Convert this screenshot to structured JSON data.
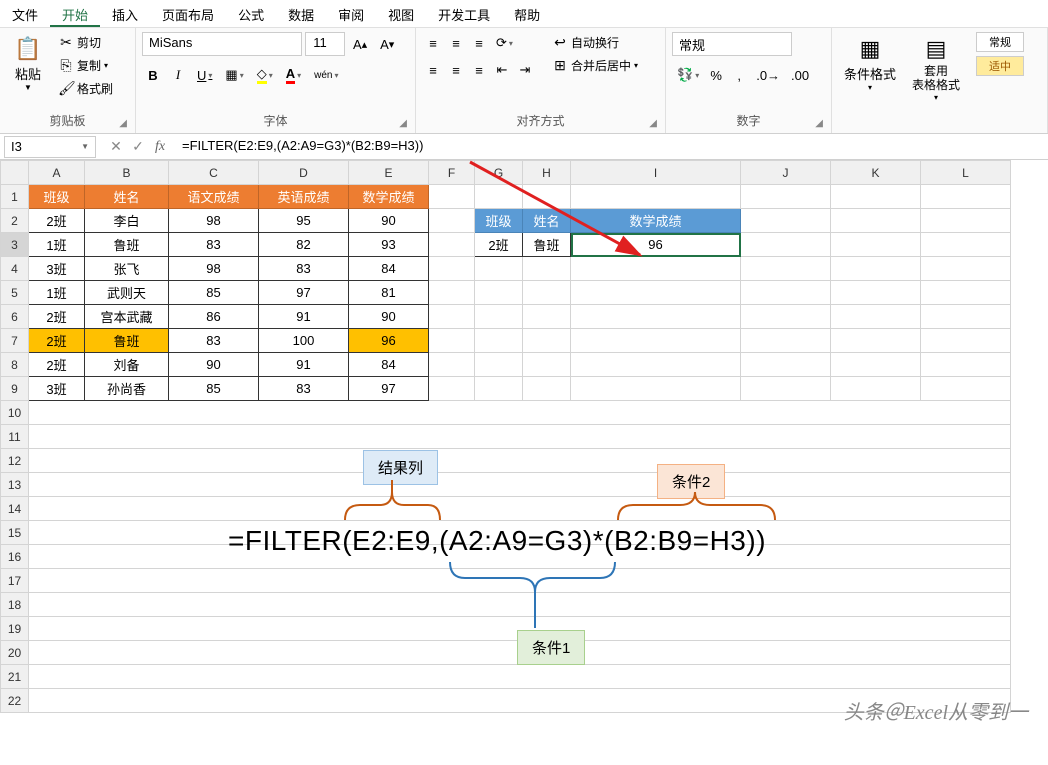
{
  "menu": {
    "file": "文件",
    "home": "开始",
    "insert": "插入",
    "layout": "页面布局",
    "formula": "公式",
    "data": "数据",
    "review": "审阅",
    "view": "视图",
    "dev": "开发工具",
    "help": "帮助"
  },
  "ribbon": {
    "clipboard": {
      "paste": "粘贴",
      "cut": "剪切",
      "copy": "复制",
      "brush": "格式刷",
      "label": "剪贴板"
    },
    "font": {
      "name": "MiSans",
      "size": "11",
      "label": "字体",
      "bold": "B",
      "italic": "I",
      "underline": "U",
      "pinyin": "wén"
    },
    "align": {
      "label": "对齐方式",
      "wrap": "自动换行",
      "merge": "合并后居中"
    },
    "number": {
      "label": "数字",
      "format": "常规"
    },
    "styles": {
      "cond": "条件格式",
      "table": "套用\n表格格式",
      "normal": "常规",
      "good": "适中"
    }
  },
  "fbar": {
    "name": "I3",
    "formula": "=FILTER(E2:E9,(A2:A9=G3)*(B2:B9=H3))"
  },
  "cols": [
    "A",
    "B",
    "C",
    "D",
    "E",
    "F",
    "G",
    "H",
    "I",
    "J",
    "K",
    "L"
  ],
  "rows": [
    "1",
    "2",
    "3",
    "4",
    "5",
    "6",
    "7",
    "8",
    "9",
    "10",
    "11",
    "12",
    "13",
    "14",
    "15",
    "16",
    "17",
    "18",
    "19",
    "20",
    "21",
    "22"
  ],
  "table1": {
    "headers": [
      "班级",
      "姓名",
      "语文成绩",
      "英语成绩",
      "数学成绩"
    ],
    "data": [
      [
        "2班",
        "李白",
        "98",
        "95",
        "90"
      ],
      [
        "1班",
        "鲁班",
        "83",
        "82",
        "93"
      ],
      [
        "3班",
        "张飞",
        "98",
        "83",
        "84"
      ],
      [
        "1班",
        "武则天",
        "85",
        "97",
        "81"
      ],
      [
        "2班",
        "宫本武藏",
        "86",
        "91",
        "90"
      ],
      [
        "2班",
        "鲁班",
        "83",
        "100",
        "96"
      ],
      [
        "2班",
        "刘备",
        "90",
        "91",
        "84"
      ],
      [
        "3班",
        "孙尚香",
        "85",
        "83",
        "97"
      ]
    ]
  },
  "table2": {
    "headers": [
      "班级",
      "姓名",
      "数学成绩"
    ],
    "data": [
      "2班",
      "鲁班",
      "96"
    ]
  },
  "anno": {
    "result": "结果列",
    "cond1": "条件1",
    "cond2": "条件2"
  },
  "bigformula": "=FILTER(E2:E9,(A2:A9=G3)*(B2:B9=H3))",
  "watermark": "头条＠Excel从零到一"
}
